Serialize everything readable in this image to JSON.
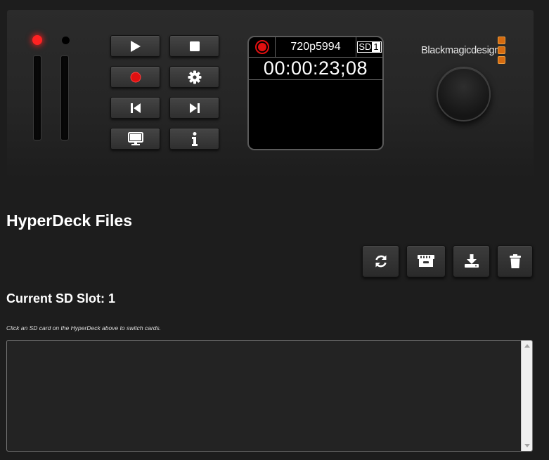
{
  "deck": {
    "format": "720p5994",
    "sd_label": "SD",
    "sd_slot": "1",
    "timecode": "00:00:23;08",
    "brand": "Blackmagicdesign",
    "record_led_color": "#ff2222",
    "brand_accent_color": "#d56b10",
    "transport_buttons": [
      {
        "icon": "play-icon"
      },
      {
        "icon": "stop-icon"
      },
      {
        "icon": "record-icon"
      },
      {
        "icon": "gear-icon"
      },
      {
        "icon": "skip-back-icon"
      },
      {
        "icon": "skip-forward-icon"
      },
      {
        "icon": "monitor-icon"
      },
      {
        "icon": "info-icon"
      }
    ]
  },
  "files": {
    "title": "HyperDeck Files",
    "current_slot_label": "Current SD Slot: 1",
    "hint": "Click an SD card on the HyperDeck above to switch cards.",
    "actions": [
      {
        "icon": "refresh-icon"
      },
      {
        "icon": "cards-icon"
      },
      {
        "icon": "download-icon"
      },
      {
        "icon": "trash-icon"
      }
    ]
  }
}
